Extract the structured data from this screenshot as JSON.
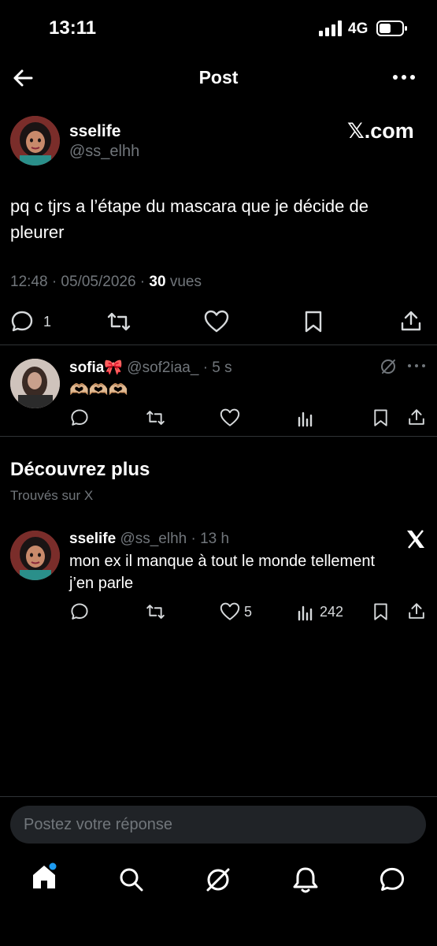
{
  "status": {
    "time": "13:11",
    "network": "4G"
  },
  "topbar": {
    "title": "Post"
  },
  "post": {
    "name": "sselife",
    "handle": "@ss_elhh",
    "source": "𝕏.com",
    "text_line1": "pq c tjrs a l’étape du mascara que je décide de",
    "text_line2": "pleurer",
    "meta_prefix": "12:48 · 05/05/2026 · ",
    "views_count": "30",
    "views_label": " vues",
    "reply_count": "1"
  },
  "reply": {
    "name": "sofia🎀",
    "handle": "@sof2iaa_",
    "time": "· 5 s",
    "text": "🫶🏼🫶🏼🫶🏼"
  },
  "discover": {
    "title": "Découvrez plus",
    "subtitle": "Trouvés sur X"
  },
  "related": {
    "name": "sselife",
    "handle": "@ss_elhh",
    "time": "· 13 h",
    "text_line1": "mon ex il manque à tout le monde tellement",
    "text_line2": "j’en parle",
    "likes": "5",
    "views": "242"
  },
  "composer": {
    "placeholder": "Postez votre réponse"
  },
  "icons": {
    "back": "arrow-left-icon",
    "more": "more-dots-icon",
    "reply": "comment-icon",
    "repost": "repost-icon",
    "like": "heart-icon",
    "bookmark": "bookmark-icon",
    "share": "share-icon",
    "views": "bar-chart-icon",
    "grok": "grok-icon",
    "x_logo": "x-logo-icon",
    "home": "home-icon",
    "search": "search-icon",
    "notifications": "bell-icon",
    "messages": "message-icon"
  },
  "colors": {
    "background": "#000000",
    "text": "#e7e9ea",
    "muted": "#71767b",
    "accent": "#1d9bf0"
  }
}
